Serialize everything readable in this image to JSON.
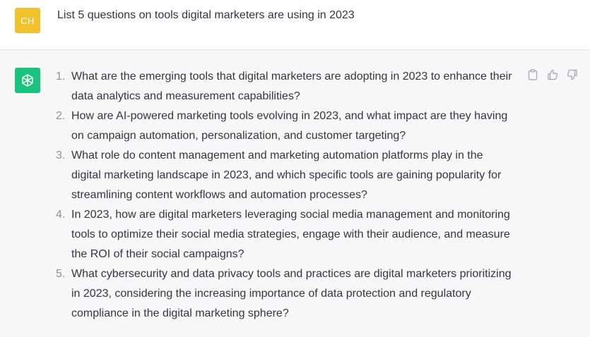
{
  "user": {
    "avatar_initials": "CH",
    "avatar_color": "#f2c12e",
    "message": "List 5 questions on tools digital marketers are using in 2023"
  },
  "assistant": {
    "avatar_icon": "openai-logo-icon",
    "avatar_color": "#19c37d",
    "items": [
      {
        "num": "1.",
        "lines": [
          "What are the emerging tools that digital marketers are adopting in 2023 to enhance their",
          "data analytics and measurement capabilities?"
        ]
      },
      {
        "num": "2.",
        "lines": [
          "How are AI-powered marketing tools evolving in 2023, and what impact are they having",
          "on campaign automation, personalization, and customer targeting?"
        ]
      },
      {
        "num": "3.",
        "lines": [
          "What role do content management and marketing automation platforms play in the",
          "digital marketing landscape in 2023, and which specific tools are gaining popularity for",
          "streamlining content workflows and automation processes?"
        ]
      },
      {
        "num": "4.",
        "lines": [
          "In 2023, how are digital marketers leveraging social media management and monitoring",
          "tools to optimize their social media strategies, engage with their audience, and measure",
          "the ROI of their social campaigns?"
        ]
      },
      {
        "num": "5.",
        "lines": [
          "What cybersecurity and data privacy tools and practices are digital marketers prioritizing",
          "in 2023, considering the increasing importance of data protection and regulatory",
          "compliance in the digital marketing sphere?"
        ]
      }
    ]
  },
  "actions": [
    {
      "name": "copy-icon"
    },
    {
      "name": "thumbs-up-icon"
    },
    {
      "name": "thumbs-down-icon"
    }
  ]
}
